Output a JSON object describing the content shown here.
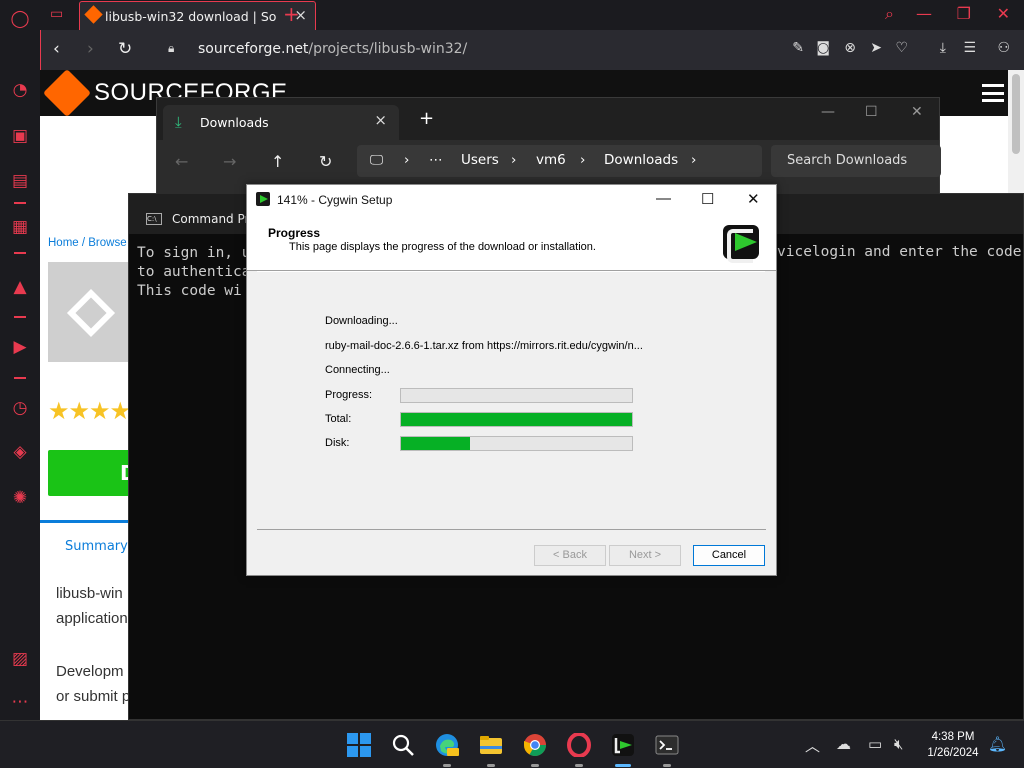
{
  "browser": {
    "tab_title": "libusb-win32 download | So",
    "url_domain": "sourceforge.net",
    "url_path": "/projects/libusb-win32/",
    "accent_color": "#e83a4f"
  },
  "sourceforge": {
    "logo_text": "SOURCEFORGE",
    "breadcrumb": "Home / Browse",
    "stars": "★★★★",
    "download_label": "D",
    "summary_tab": "Summary",
    "desc_line1": "libusb-win",
    "desc_line2": "application",
    "desc_line3": "Developm",
    "desc_line4": "or submit p"
  },
  "cmd": {
    "title": "Command Prompt",
    "line1_left": "To sign in, u",
    "line2_left": "to authentica",
    "line3_left": "This code wi",
    "line1_right": "vicelogin and enter the code"
  },
  "explorer": {
    "tab_title": "Downloads",
    "path": [
      "Users",
      "vm6",
      "Downloads"
    ],
    "search_placeholder": "Search Downloads"
  },
  "cygwin": {
    "window_title": "141% - Cygwin Setup",
    "header_title": "Progress",
    "header_subtitle": "This page displays the progress of the download or installation.",
    "status_line1": "Downloading...",
    "status_line2": "ruby-mail-doc-2.6.6-1.tar.xz from https://mirrors.rit.edu/cygwin/n...",
    "status_line3": "Connecting...",
    "progress_label": "Progress:",
    "total_label": "Total:",
    "disk_label": "Disk:",
    "progress_fraction": 0.0,
    "total_fraction": 1.0,
    "disk_fraction": 0.3,
    "back_label": "< Back",
    "next_label": "Next >",
    "cancel_label": "Cancel"
  },
  "taskbar": {
    "time": "4:38 PM",
    "date": "1/26/2024"
  }
}
